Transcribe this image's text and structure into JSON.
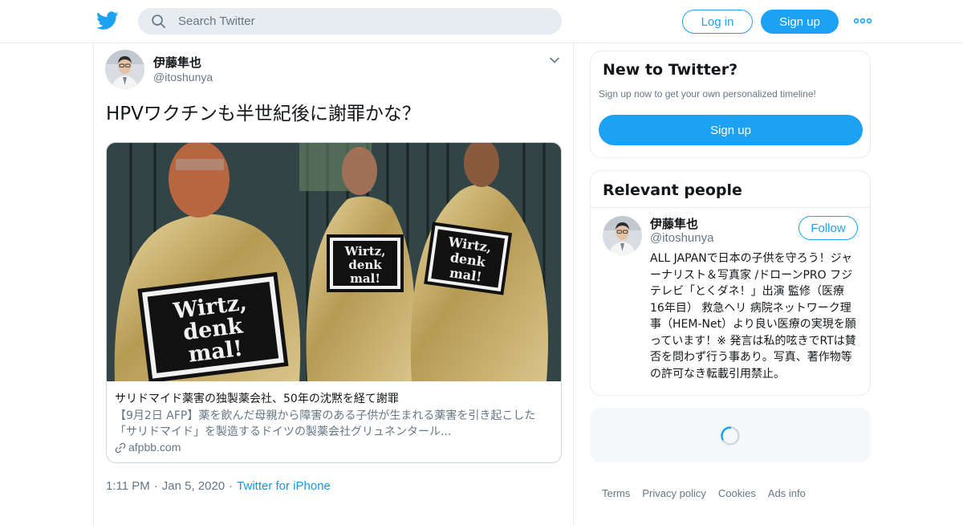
{
  "header": {
    "search_placeholder": "Search Twitter",
    "login_label": "Log in",
    "signup_label": "Sign up",
    "brand_color": "#1da1f2",
    "logo_icon": "twitter-bird-icon",
    "more_icon": "more-dots-icon"
  },
  "tweet": {
    "display_name": "伊藤隼也",
    "handle": "@itoshunya",
    "text": "HPVワクチンも半世紀後に謝罪かな？",
    "card": {
      "image_sign_text": [
        "Wirtz,",
        "denk",
        "mal!"
      ],
      "title": "サリドマイド薬害の独製薬会社、50年の沈黙を経て謝罪",
      "description": "【9月2日 AFP】薬を飲んだ母親から障害のある子供が生まれる薬害を引き起こした「サリドマイド」を製造するドイツの製薬会社グリュネンタール...",
      "domain": "afpbb.com"
    },
    "time": "1:11 PM",
    "date": "Jan 5, 2020",
    "source": "Twitter for iPhone",
    "separator": "·"
  },
  "sidebar": {
    "new_to_twitter": {
      "title": "New to Twitter?",
      "subtitle": "Sign up now to get your own personalized timeline!",
      "button": "Sign up"
    },
    "relevant_people": {
      "title": "Relevant people",
      "person": {
        "display_name": "伊藤隼也",
        "handle": "@itoshunya",
        "follow_label": "Follow",
        "bio": "ALL JAPANで日本の子供を守ろう！ジャーナリスト＆写真家 /ドローンPRO フジテレビ「とくダネ！」出演 監修（医療 16年目） 救急ヘリ 病院ネットワーク理事（HEM-Net）より良い医療の実現を願っています！※ 発言は私的呟きでRTは賛否を問わず行う事あり。写真、著作物等の許可なき転載引用禁止。"
      }
    }
  },
  "footer": {
    "links": [
      "Terms",
      "Privacy policy",
      "Cookies",
      "Ads info"
    ]
  }
}
